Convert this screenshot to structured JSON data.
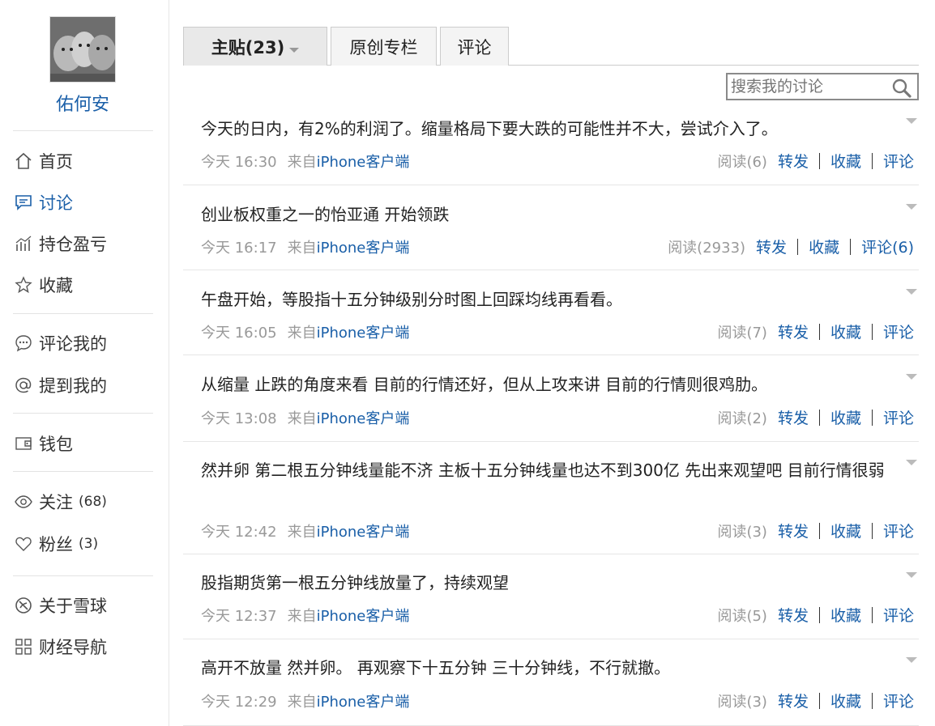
{
  "sidebar": {
    "username": "佑何安",
    "nav": [
      {
        "label": "首页",
        "icon": "home-icon"
      },
      {
        "label": "讨论",
        "icon": "discussion-icon"
      },
      {
        "label": "持仓盈亏",
        "icon": "holdings-chart-icon"
      },
      {
        "label": "收藏",
        "icon": "star-icon"
      },
      {
        "label": "评论我的",
        "icon": "comment-bubble-icon"
      },
      {
        "label": "提到我的",
        "icon": "at-icon"
      },
      {
        "label": "钱包",
        "icon": "wallet-icon"
      },
      {
        "label": "关注",
        "count": "(68)",
        "icon": "eye-icon"
      },
      {
        "label": "粉丝",
        "count": "(3)",
        "icon": "heart-icon"
      },
      {
        "label": "关于雪球",
        "icon": "snowball-logo-icon"
      },
      {
        "label": "财经导航",
        "icon": "grid-icon"
      }
    ]
  },
  "tabs": [
    {
      "label": "主贴(23)"
    },
    {
      "label": "原创专栏"
    },
    {
      "label": "评论"
    }
  ],
  "search": {
    "placeholder": "搜索我的讨论"
  },
  "actions": {
    "forward": "转发",
    "favorite": "收藏",
    "comment": "评论"
  },
  "posts": [
    {
      "text": "今天的日内，有2%的利润了。缩量格局下要大跌的可能性并不大，尝试介入了。",
      "time": "今天 16:30",
      "from": "来自",
      "source": "iPhone客户端",
      "reads": "阅读(6)",
      "comment_label": "评论"
    },
    {
      "text": "创业板权重之一的怡亚通 开始领跌",
      "time": "今天 16:17",
      "from": "来自",
      "source": "iPhone客户端",
      "reads": "阅读(2933)",
      "comment_label": "评论(6)"
    },
    {
      "text": "午盘开始，等股指十五分钟级别分时图上回踩均线再看看。",
      "time": "今天 16:05",
      "from": "来自",
      "source": "iPhone客户端",
      "reads": "阅读(7)",
      "comment_label": "评论"
    },
    {
      "text": "从缩量 止跌的角度来看 目前的行情还好，但从上攻来讲 目前的行情则很鸡肋。",
      "time": "今天 13:08",
      "from": "来自",
      "source": "iPhone客户端",
      "reads": "阅读(2)",
      "comment_label": "评论"
    },
    {
      "text": "然并卵 第二根五分钟线量能不济 主板十五分钟线量也达不到300亿 先出来观望吧 目前行情很弱",
      "time": "今天 12:42",
      "from": "来自",
      "source": "iPhone客户端",
      "reads": "阅读(3)",
      "comment_label": "评论"
    },
    {
      "text": "股指期货第一根五分钟线放量了，持续观望",
      "time": "今天 12:37",
      "from": "来自",
      "source": "iPhone客户端",
      "reads": "阅读(5)",
      "comment_label": "评论"
    },
    {
      "text": "高开不放量 然并卵。 再观察下十五分钟 三十分钟线，不行就撤。",
      "time": "今天 12:29",
      "from": "来自",
      "source": "iPhone客户端",
      "reads": "阅读(3)",
      "comment_label": "评论"
    }
  ]
}
